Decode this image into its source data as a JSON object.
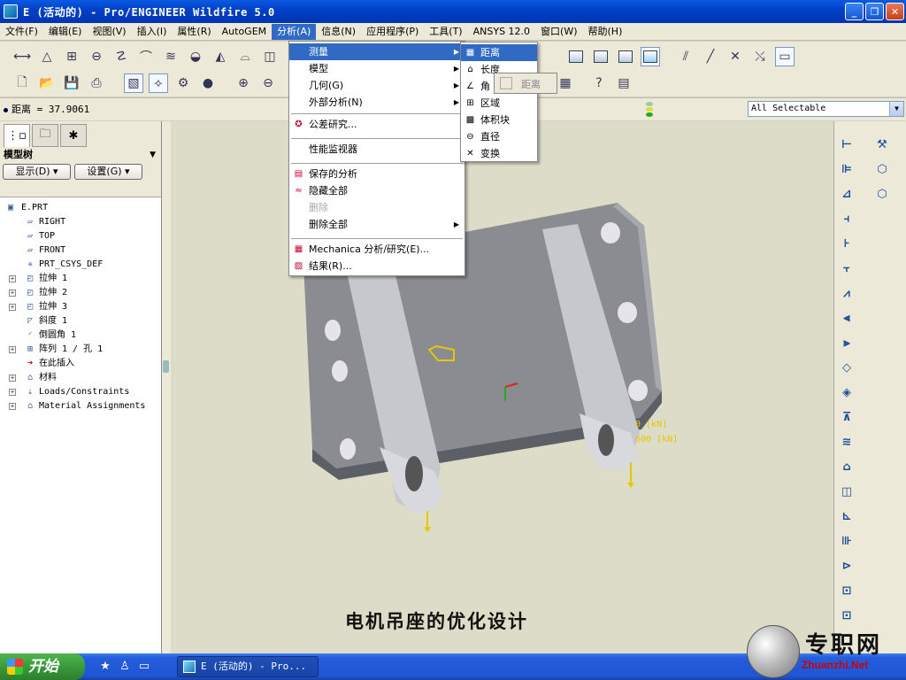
{
  "window": {
    "title": "E (活动的) - Pro/ENGINEER Wildfire 5.0",
    "minimize": "_",
    "maximize": "❐",
    "close": "✕"
  },
  "menubar": [
    {
      "label": "文件(F)"
    },
    {
      "label": "编辑(E)"
    },
    {
      "label": "视图(V)"
    },
    {
      "label": "插入(I)"
    },
    {
      "label": "属性(R)"
    },
    {
      "label": "AutoGEM"
    },
    {
      "label": "分析(A)",
      "active": true
    },
    {
      "label": "信息(N)"
    },
    {
      "label": "应用程序(P)"
    },
    {
      "label": "工具(T)"
    },
    {
      "label": "ANSYS 12.0"
    },
    {
      "label": "窗口(W)"
    },
    {
      "label": "帮助(H)"
    }
  ],
  "analysis_menu": {
    "items": [
      {
        "label": "测量",
        "submenu": true,
        "highlighted": true
      },
      {
        "label": "模型",
        "submenu": true
      },
      {
        "label": "几何(G)",
        "submenu": true
      },
      {
        "label": "外部分析(N)",
        "submenu": true
      },
      {
        "label": "公差研究..."
      },
      {
        "label": "性能监视器"
      },
      {
        "label": "保存的分析"
      },
      {
        "label": "隐藏全部"
      },
      {
        "label": "删除",
        "disabled": true
      },
      {
        "label": "删除全部",
        "submenu": true
      },
      {
        "label": "Mechanica 分析/研究(E)..."
      },
      {
        "label": "结果(R)..."
      }
    ]
  },
  "measure_submenu": {
    "items": [
      {
        "label": "距离",
        "highlighted": true
      },
      {
        "label": "长度"
      },
      {
        "label": "角"
      },
      {
        "label": "区域"
      },
      {
        "label": "体积块"
      },
      {
        "label": "直径"
      },
      {
        "label": "变换"
      }
    ]
  },
  "tooltip": {
    "label": "距离"
  },
  "statusline": {
    "message": "距离 = 37.9061",
    "filter_value": "All Selectable"
  },
  "model_tree": {
    "header": "模型树",
    "show_button": "显示(D)",
    "settings_button": "设置(G)",
    "items": [
      {
        "label": "E.PRT",
        "indent": 0,
        "icon": "part-icon"
      },
      {
        "label": "RIGHT",
        "indent": 1,
        "icon": "datum-plane-icon"
      },
      {
        "label": "TOP",
        "indent": 1,
        "icon": "datum-plane-icon"
      },
      {
        "label": "FRONT",
        "indent": 1,
        "icon": "datum-plane-icon"
      },
      {
        "label": "PRT_CSYS_DEF",
        "indent": 1,
        "icon": "csys-icon"
      },
      {
        "label": "拉伸 1",
        "indent": 1,
        "icon": "extrude-icon",
        "expandable": true
      },
      {
        "label": "拉伸 2",
        "indent": 1,
        "icon": "extrude-icon",
        "expandable": true
      },
      {
        "label": "拉伸 3",
        "indent": 1,
        "icon": "extrude-icon",
        "expandable": true
      },
      {
        "label": "斜度 1",
        "indent": 1,
        "icon": "draft-icon"
      },
      {
        "label": "倒圆角 1",
        "indent": 1,
        "icon": "round-icon"
      },
      {
        "label": "阵列 1 / 孔 1",
        "indent": 1,
        "icon": "pattern-icon",
        "expandable": true
      },
      {
        "label": "在此插入",
        "indent": 1,
        "icon": "insert-here-icon"
      },
      {
        "label": "材料",
        "indent": 1,
        "icon": "material-icon",
        "expandable": true
      },
      {
        "label": "Loads/Constraints",
        "indent": 1,
        "icon": "loads-icon",
        "expandable": true
      },
      {
        "label": "Material Assignments",
        "indent": 1,
        "icon": "material-assign-icon",
        "expandable": true
      }
    ]
  },
  "viewport": {
    "load_label_1": "0 [kN]",
    "load_label_2": "600 [kN]",
    "caption": "电机吊座的优化设计"
  },
  "taskbar": {
    "start_label": "开始",
    "task_item": "E (活动的) - Pro..."
  },
  "brand": {
    "name": "专职网",
    "url": "Zhuanzhi.Net"
  },
  "colors": {
    "title_bar": "#0041c8",
    "menu_highlight": "#316ac5",
    "part_gray": "#8a8c92",
    "viewport_bg": "#dcdcc8",
    "taskbar": "#245edc",
    "start_green": "#3a9a3a",
    "load_yellow": "#e6c800"
  }
}
